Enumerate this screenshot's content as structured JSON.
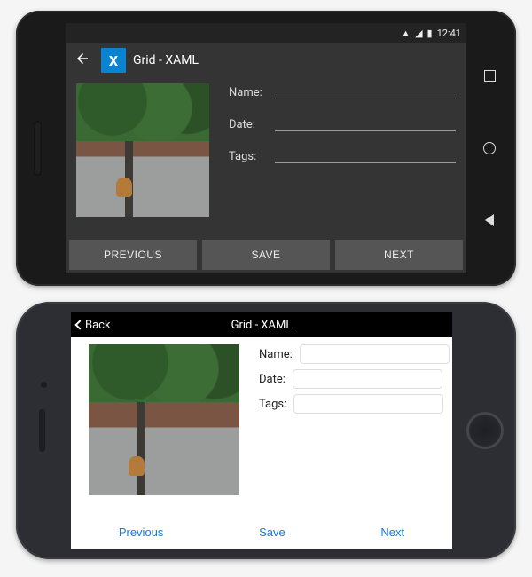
{
  "android": {
    "status": {
      "time": "12:41"
    },
    "toolbar": {
      "title": "Grid - XAML"
    },
    "fields": {
      "name_label": "Name:",
      "date_label": "Date:",
      "tags_label": "Tags:",
      "name_value": "",
      "date_value": "",
      "tags_value": ""
    },
    "buttons": {
      "prev": "PREVIOUS",
      "save": "SAVE",
      "next": "NEXT"
    }
  },
  "ios": {
    "nav": {
      "back": "Back",
      "title": "Grid - XAML"
    },
    "fields": {
      "name_label": "Name:",
      "date_label": "Date:",
      "tags_label": "Tags:",
      "name_value": "",
      "date_value": "",
      "tags_value": ""
    },
    "buttons": {
      "prev": "Previous",
      "save": "Save",
      "next": "Next"
    }
  }
}
